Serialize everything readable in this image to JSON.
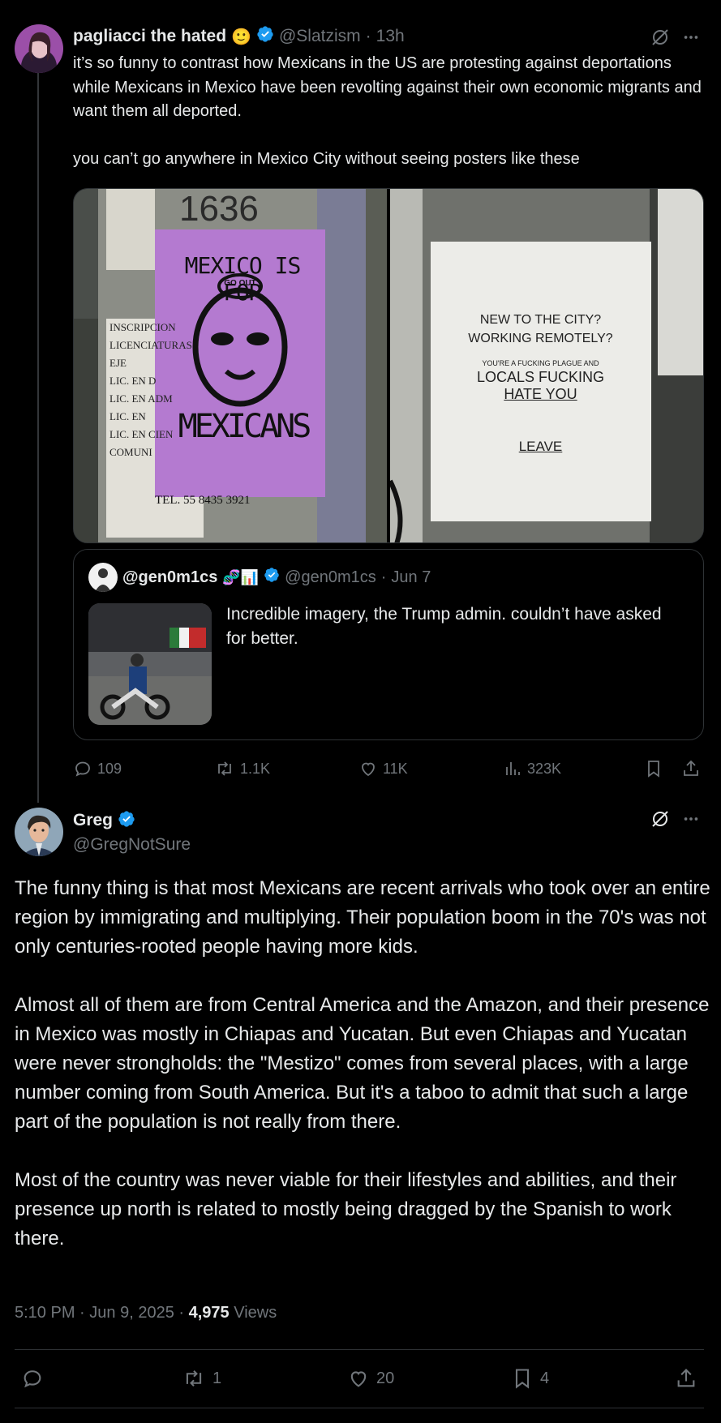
{
  "tweet1": {
    "display_name": "pagliacci the hated",
    "emoji": "🙂",
    "handle": "@Slatzism",
    "separator": "·",
    "time": "13h",
    "text": [
      "it’s so funny to contrast how Mexicans in the US are protesting against deportations while Mexicans in Mexico have been revolting against their own economic migrants and want them all deported.",
      "you can’t go anywhere in Mexico City without seeing posters like these"
    ],
    "poster_left": {
      "line1": "MEXICO IS FOR",
      "mask_text": "GO OUT",
      "line2": "MEXICANS",
      "phone": "TEL. 55 8435 3921",
      "side_text": [
        "INSCRIPCION",
        "LICENCIATURAS EJE",
        "LIC. EN D",
        "LIC. EN ADM",
        "LIC. EN",
        "LIC. EN CIEN",
        "COMUNI"
      ],
      "top_number": "1636"
    },
    "poster_right": {
      "line1": "NEW TO THE CITY?",
      "line2": "WORKING REMOTELY?",
      "line3": "YOU'RE A FUCKING PLAGUE AND",
      "line4": "LOCALS FUCKING",
      "line5": "HATE YOU",
      "line6": "LEAVE"
    },
    "quote": {
      "display_name": "@gen0m1cs",
      "emojis": "🧬📊",
      "handle": "@gen0m1cs",
      "separator": "·",
      "date": "Jun 7",
      "text": "Incredible imagery, the Trump admin. couldn’t have asked for better."
    },
    "actions": {
      "replies": "109",
      "reposts": "1.1K",
      "likes": "11K",
      "views": "323K"
    }
  },
  "tweet2": {
    "display_name": "Greg",
    "handle": "@GregNotSure",
    "paragraphs": [
      "The funny thing is that most Mexicans are recent arrivals who took over an entire region by immigrating and multiplying. Their population boom in the 70's was not only centuries-rooted people having more kids.",
      "Almost all of them are from Central America and the Amazon, and their presence in Mexico was mostly in Chiapas and Yucatan. But even Chiapas and Yucatan were never strongholds: the \"Mestizo\" comes from several places, with a large number coming from South America. But it's a taboo to admit that such a large part of the population is not really from there.",
      "Most of the country was never viable for their lifestyles and abilities, and their presence up north is related to mostly being dragged by the Spanish to work there."
    ],
    "meta": {
      "time": "5:10 PM",
      "sep1": "·",
      "date": "Jun 9, 2025",
      "sep2": "·",
      "views_count": "4,975",
      "views_label": "Views"
    },
    "actions": {
      "reposts": "1",
      "likes": "20",
      "bookmarks": "4"
    }
  },
  "colors": {
    "background": "#000000",
    "text": "#e7e9ea",
    "muted": "#71767b",
    "verified": "#1d9bf0",
    "border": "#2f3336",
    "poster_purple": "#b47ad0"
  },
  "icons": [
    "verified-badge-icon",
    "grok-icon",
    "more-icon",
    "reply-icon",
    "repost-icon",
    "like-icon",
    "views-icon",
    "bookmark-icon",
    "share-icon"
  ]
}
